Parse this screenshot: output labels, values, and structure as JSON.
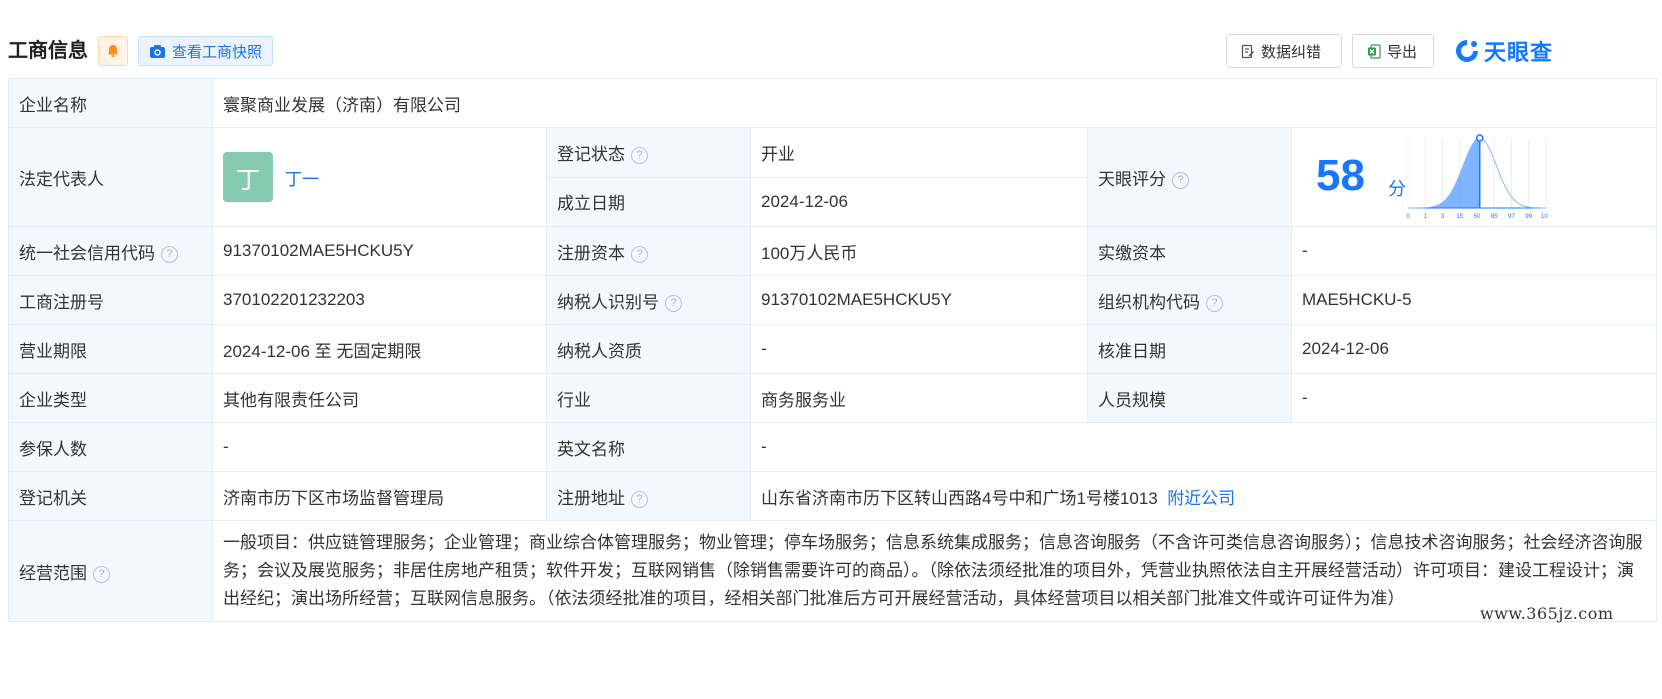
{
  "header": {
    "title": "工商信息",
    "snapshot_label": "查看工商快照",
    "correct_label": "数据纠错",
    "export_label": "导出",
    "logo_text": "天眼查"
  },
  "rows": {
    "company_name": {
      "label": "企业名称",
      "value": "寰聚商业发展（济南）有限公司"
    },
    "legal_rep": {
      "label": "法定代表人",
      "avatar": "丁",
      "name": "丁一"
    },
    "reg_status": {
      "label": "登记状态",
      "value": "开业"
    },
    "founded": {
      "label": "成立日期",
      "value": "2024-12-06"
    },
    "score": {
      "label": "天眼评分",
      "value": "58",
      "unit": "分",
      "ticks": [
        "0",
        "1",
        "3",
        "15",
        "50",
        "85",
        "97",
        "99",
        "100"
      ],
      "level": 0.52
    },
    "credit_code": {
      "label": "统一社会信用代码",
      "value": "91370102MAE5HCKU5Y"
    },
    "reg_capital": {
      "label": "注册资本",
      "value": "100万人民币"
    },
    "paid_capital": {
      "label": "实缴资本",
      "value": "-"
    },
    "reg_no": {
      "label": "工商注册号",
      "value": "370102201232203"
    },
    "taxpayer_id": {
      "label": "纳税人识别号",
      "value": "91370102MAE5HCKU5Y"
    },
    "org_code": {
      "label": "组织机构代码",
      "value": "MAE5HCKU-5"
    },
    "term": {
      "label": "营业期限",
      "value": "2024-12-06 至 无固定期限"
    },
    "taxpayer_qual": {
      "label": "纳税人资质",
      "value": "-"
    },
    "approval_date": {
      "label": "核准日期",
      "value": "2024-12-06"
    },
    "company_type": {
      "label": "企业类型",
      "value": "其他有限责任公司"
    },
    "industry": {
      "label": "行业",
      "value": "商务服务业"
    },
    "staff_size": {
      "label": "人员规模",
      "value": "-"
    },
    "insured": {
      "label": "参保人数",
      "value": "-"
    },
    "english_name": {
      "label": "英文名称",
      "value": "-"
    },
    "authority": {
      "label": "登记机关",
      "value": "济南市历下区市场监督管理局"
    },
    "address": {
      "label": "注册地址",
      "value": "山东省济南市历下区转山西路4号中和广场1号楼1013",
      "link": "附近公司"
    },
    "scope": {
      "label": "经营范围",
      "value": "一般项目：供应链管理服务；企业管理；商业综合体管理服务；物业管理；停车场服务；信息系统集成服务；信息咨询服务（不含许可类信息咨询服务）；信息技术咨询服务；社会经济咨询服务；会议及展览服务；非居住房地产租赁；软件开发；互联网销售（除销售需要许可的商品）。（除依法须经批准的项目外，凭营业执照依法自主开展经营活动）许可项目：建设工程设计；演出经纪；演出场所经营；互联网信息服务。（依法须经批准的项目，经相关部门批准后方可开展经营活动，具体经营项目以相关部门批准文件或许可证件为准）"
    }
  },
  "help_glyph": "?",
  "watermark": "www.365jz.com",
  "colors": {
    "accent": "#1677ff",
    "status_open": "#1f9d55",
    "label_bg": "#f2f8fe"
  }
}
